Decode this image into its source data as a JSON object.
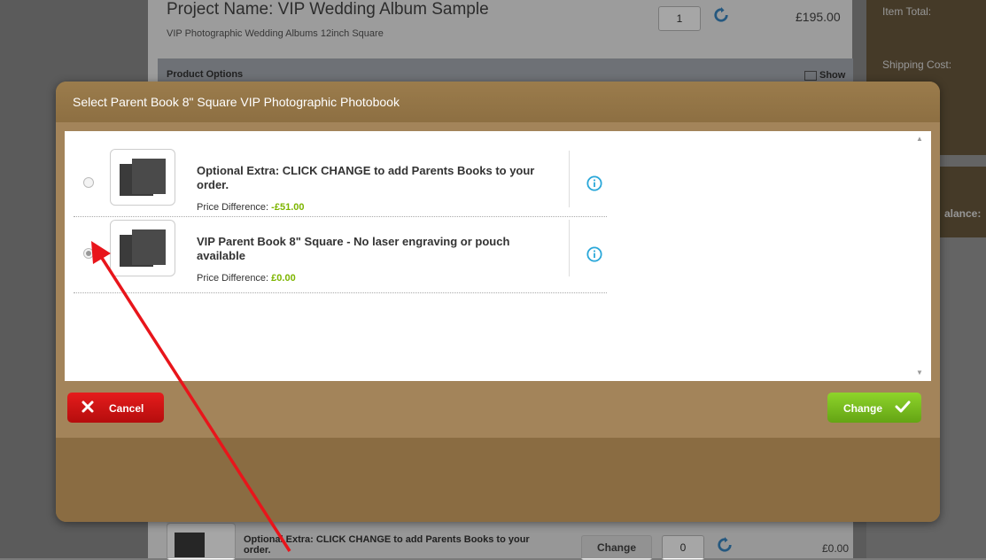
{
  "background": {
    "project_title": "Project Name: VIP Wedding Album Sample",
    "project_subtitle": "VIP Photographic Wedding Albums 12inch Square",
    "quantity": "1",
    "price": "£195.00",
    "product_options_label": "Product Options",
    "show_label": "Show",
    "sidebar": {
      "item_total": "Item Total:",
      "shipping_cost": "Shipping Cost:",
      "balance_fragment": "alance:"
    },
    "bottom_row": {
      "text": "Optional Extra: CLICK CHANGE to add Parents Books to your order.",
      "change_label": "Change",
      "quantity": "0",
      "price": "£0.00"
    }
  },
  "modal": {
    "title": "Select Parent Book 8\" Square VIP Photographic Photobook",
    "options": [
      {
        "name": "Optional Extra: CLICK CHANGE to add Parents Books to your order.",
        "price_label": "Price Difference: ",
        "price_value": "-£51.00",
        "selected": false
      },
      {
        "name": "VIP Parent Book 8\" Square - No laser engraving or pouch available",
        "price_label": "Price Difference: ",
        "price_value": "£0.00",
        "selected": true
      }
    ],
    "cancel_label": "Cancel",
    "change_label": "Change"
  },
  "colors": {
    "modal_brown": "#9a7b4c",
    "price_green": "#7db500",
    "cancel_red": "#d01414",
    "change_green": "#7cc21f",
    "info_blue": "#29a7d9",
    "annotation_arrow": "#e8151b"
  },
  "icons": {
    "refresh": "refresh-icon",
    "info": "info-icon",
    "cancel": "close-icon",
    "change": "checkmark-icon"
  }
}
